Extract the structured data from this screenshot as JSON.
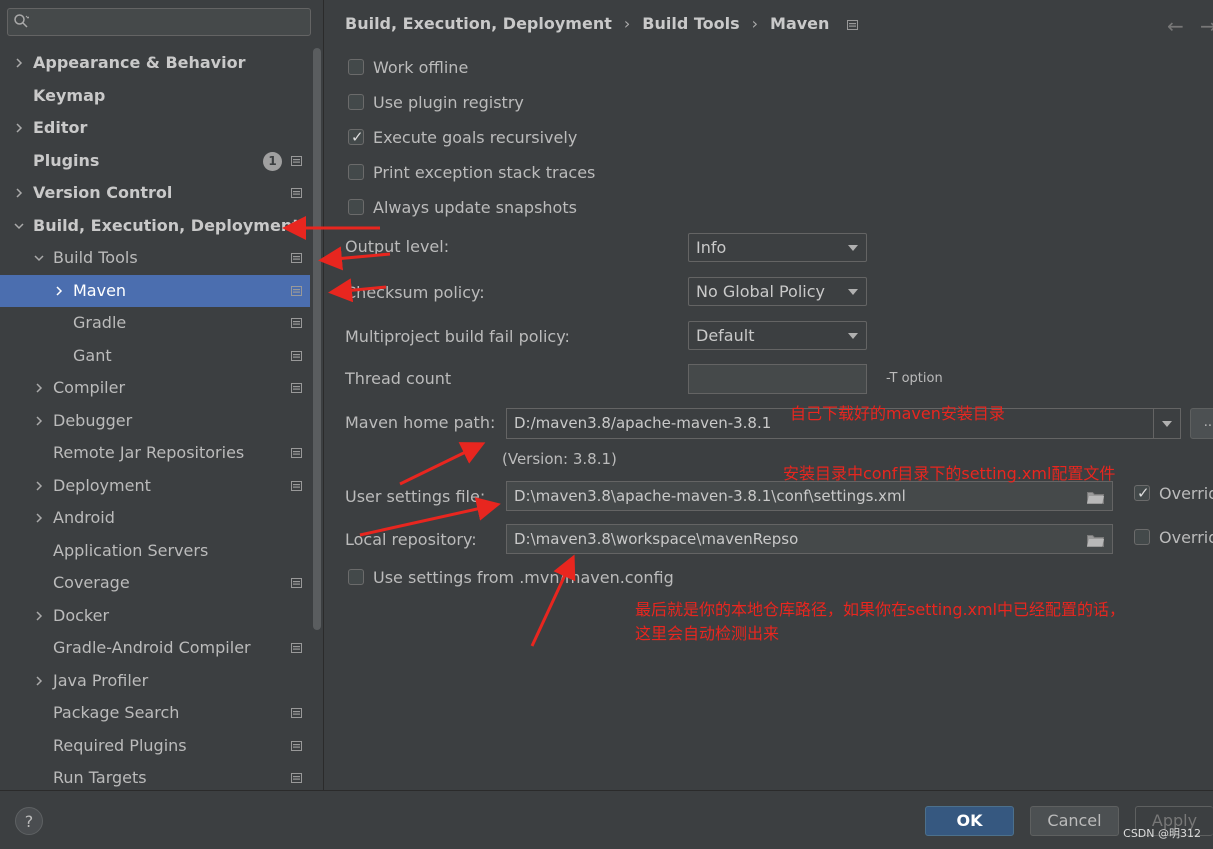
{
  "search": {
    "placeholder": "",
    "icon": "search-icon"
  },
  "tree": [
    {
      "label": "Appearance & Behavior",
      "level": 0,
      "chevron": "right",
      "bold": true,
      "pg": false
    },
    {
      "label": "Keymap",
      "level": 0,
      "chevron": "none",
      "bold": true,
      "pg": false
    },
    {
      "label": "Editor",
      "level": 0,
      "chevron": "right",
      "bold": true,
      "pg": false
    },
    {
      "label": "Plugins",
      "level": 0,
      "chevron": "none",
      "bold": true,
      "pg": true,
      "badge": "1"
    },
    {
      "label": "Version Control",
      "level": 0,
      "chevron": "right",
      "bold": true,
      "pg": true
    },
    {
      "label": "Build, Execution, Deployment",
      "level": 0,
      "chevron": "down",
      "bold": true,
      "pg": false
    },
    {
      "label": "Build Tools",
      "level": 1,
      "chevron": "down",
      "bold": false,
      "pg": true
    },
    {
      "label": "Maven",
      "level": 2,
      "chevron": "right",
      "bold": false,
      "pg": true,
      "selected": true
    },
    {
      "label": "Gradle",
      "level": 2,
      "chevron": "none",
      "bold": false,
      "pg": true
    },
    {
      "label": "Gant",
      "level": 2,
      "chevron": "none",
      "bold": false,
      "pg": true
    },
    {
      "label": "Compiler",
      "level": 1,
      "chevron": "right",
      "bold": false,
      "pg": true
    },
    {
      "label": "Debugger",
      "level": 1,
      "chevron": "right",
      "bold": false,
      "pg": false
    },
    {
      "label": "Remote Jar Repositories",
      "level": 1,
      "chevron": "none",
      "bold": false,
      "pg": true
    },
    {
      "label": "Deployment",
      "level": 1,
      "chevron": "right",
      "bold": false,
      "pg": true
    },
    {
      "label": "Android",
      "level": 1,
      "chevron": "right",
      "bold": false,
      "pg": false
    },
    {
      "label": "Application Servers",
      "level": 1,
      "chevron": "none",
      "bold": false,
      "pg": false
    },
    {
      "label": "Coverage",
      "level": 1,
      "chevron": "none",
      "bold": false,
      "pg": true
    },
    {
      "label": "Docker",
      "level": 1,
      "chevron": "right",
      "bold": false,
      "pg": false
    },
    {
      "label": "Gradle-Android Compiler",
      "level": 1,
      "chevron": "none",
      "bold": false,
      "pg": true
    },
    {
      "label": "Java Profiler",
      "level": 1,
      "chevron": "right",
      "bold": false,
      "pg": false
    },
    {
      "label": "Package Search",
      "level": 1,
      "chevron": "none",
      "bold": false,
      "pg": true
    },
    {
      "label": "Required Plugins",
      "level": 1,
      "chevron": "none",
      "bold": false,
      "pg": true
    },
    {
      "label": "Run Targets",
      "level": 1,
      "chevron": "none",
      "bold": false,
      "pg": true
    }
  ],
  "breadcrumb": {
    "part1": "Build, Execution, Deployment",
    "part2": "Build Tools",
    "part3": "Maven",
    "sep": "›"
  },
  "nav": {
    "back": "←",
    "forward": "→"
  },
  "checks": [
    {
      "label": "Work offline",
      "checked": false
    },
    {
      "label": "Use plugin registry",
      "checked": false
    },
    {
      "label": "Execute goals recursively",
      "checked": true
    },
    {
      "label": "Print exception stack traces",
      "checked": false
    },
    {
      "label": "Always update snapshots",
      "checked": false
    }
  ],
  "tick": "✓",
  "form": {
    "output_level_label": "Output level:",
    "output_level_value": "Info",
    "checksum_label": "Checksum policy:",
    "checksum_value": "No Global Policy",
    "multiproject_label": "Multiproject build fail policy:",
    "multiproject_value": "Default",
    "thread_label": "Thread count",
    "thread_value": "",
    "thread_hint": "-T option",
    "home_label": "Maven home path:",
    "home_value": "D:/maven3.8/apache-maven-3.8.1",
    "home_browse": "...",
    "version": "(Version: 3.8.1)",
    "user_settings_label": "User settings file:",
    "user_settings_value": "D:\\maven3.8\\apache-maven-3.8.1\\conf\\settings.xml",
    "override1": "Override",
    "local_repo_label": "Local repository:",
    "local_repo_value": "D:\\maven3.8\\workspace\\mavenRepso",
    "override2": "Override",
    "mvn_config_label": "Use settings from .mvn/maven.config"
  },
  "notes": {
    "note1": "自己下载好的maven安装目录",
    "note2": "安装目录中conf目录下的setting.xml配置文件",
    "note3_line1": "最后就是你的本地仓库路径，如果你在setting.xml中已经配置的话，",
    "note3_line2": "这里会自动检测出来"
  },
  "buttons": {
    "help": "?",
    "ok": "OK",
    "cancel": "Cancel",
    "apply": "Apply"
  },
  "watermark": "CSDN @明312",
  "colors": {
    "selection": "#4b6eaf",
    "annotation": "#e8261f",
    "ok_button": "#365880"
  }
}
